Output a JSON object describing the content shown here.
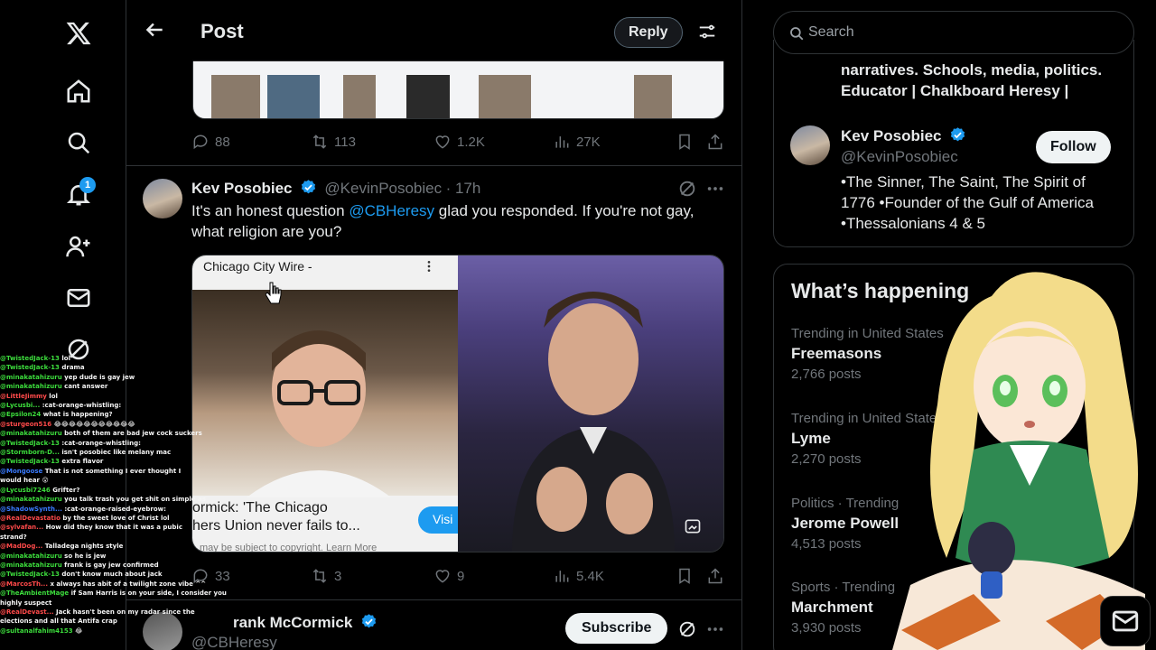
{
  "topbar": {
    "title": "Post",
    "reply_label": "Reply"
  },
  "nav": {
    "notification_count": "1"
  },
  "prev_tweet": {
    "replies": "88",
    "reposts": "113",
    "likes": "1.2K",
    "views": "27K"
  },
  "tweet": {
    "author": "Kev Posobiec",
    "handle": "@KevinPosobiec",
    "time": "· 17h",
    "text_before": "It's an honest question ",
    "mention": "@CBHeresy",
    "text_after": " glad you responded. If you're not gay, what religion are you?",
    "media": {
      "header": "Chicago City Wire -",
      "caption_line1": "ormick: 'The Chicago",
      "caption_line2": "hers Union never fails to...",
      "small_text": "may be subject to copyright.  Learn More",
      "visit_label": "Visi"
    },
    "replies": "33",
    "reposts": "3",
    "likes": "9",
    "views": "5.4K"
  },
  "next_tweet": {
    "author": "Frank McCormick",
    "author_visible": "rank McCormick",
    "handle": "@CBHeresy",
    "subscribe_label": "Subscribe"
  },
  "chat": [
    {
      "user": "@TwistedJack-13",
      "msg": "lol",
      "color": "green"
    },
    {
      "user": "@TwistedJack-13",
      "msg": "drama",
      "color": "green"
    },
    {
      "user": "@minakatahizuru",
      "msg": "yep dude is gay jew",
      "color": "green"
    },
    {
      "user": "@minakatahizuru",
      "msg": "cant answer",
      "color": "green"
    },
    {
      "user": "@LittleJimmy",
      "msg": "lol",
      "color": "red"
    },
    {
      "user": "@Lycusbi...",
      "msg": ":cat-orange-whistling:",
      "color": "green"
    },
    {
      "user": "@Epsilon24",
      "msg": "what is happening?",
      "color": "green"
    },
    {
      "user": "@sturgeon516",
      "msg": "😂😂😂😂😂😂😂😂😂😂😂",
      "color": "red"
    },
    {
      "user": "@minakatahizuru",
      "msg": "both of them are bad jew cock suckers",
      "color": "green"
    },
    {
      "user": "@TwistedJack-13",
      "msg": ":cat-orange-whistling:",
      "color": "green"
    },
    {
      "user": "@Stormborn-D...",
      "msg": "isn't posobiec like melany mac",
      "color": "green"
    },
    {
      "user": "@TwistedJack-13",
      "msg": "extra flavor",
      "color": "green"
    },
    {
      "user": "@Mongoose",
      "msg": "That is not something I ever thought I",
      "color": "blue"
    },
    {
      "user": "",
      "msg": "would hear 😮",
      "color": "green"
    },
    {
      "user": "@Lycusbi7246",
      "msg": "Grifter?",
      "color": "green"
    },
    {
      "user": "@minakatahizuru",
      "msg": "you talk trash you get shit on simple as",
      "color": "green"
    },
    {
      "user": "",
      "msg": "",
      "color": "green"
    },
    {
      "user": "@ShadowSynth...",
      "msg": ":cat-orange-raised-eyebrow:",
      "color": "blue"
    },
    {
      "user": "@RealDevastatio",
      "msg": "by the sweet love of Christ lol",
      "color": "red"
    },
    {
      "user": "@sylvafan...",
      "msg": "How did they know that it was a pubic",
      "color": "red"
    },
    {
      "user": "",
      "msg": "strand?",
      "color": "green"
    },
    {
      "user": "@MadDog...",
      "msg": "Talladega nights style",
      "color": "red"
    },
    {
      "user": "@minakatahizuru",
      "msg": "so he is jew",
      "color": "green"
    },
    {
      "user": "@minakatahizuru",
      "msg": "frank is gay jew confirmed",
      "color": "green"
    },
    {
      "user": "@TwistedJack-13",
      "msg": "don't know much about jack",
      "color": "green"
    },
    {
      "user": "@MarcosTh...",
      "msg": "x always has abit of a twilight zone vibe ^^",
      "color": "red"
    },
    {
      "user": "@TheAmbientMage",
      "msg": "if Sam Harris is on your side, I consider you",
      "color": "green"
    },
    {
      "user": "",
      "msg": "highly suspect",
      "color": "green"
    },
    {
      "user": "@RealDevast...",
      "msg": "Jack hasn't been on my radar since the",
      "color": "red"
    },
    {
      "user": "",
      "msg": "elections and all that Antifa crap",
      "color": "green"
    },
    {
      "user": "@sultanalfahim4153",
      "msg": "😂",
      "color": "green"
    }
  ],
  "sidebar": {
    "search_placeholder": "Search",
    "prev_bio_line1": "narratives. Schools, media, politics.",
    "prev_bio_line2": "Educator | Chalkboard Heresy |",
    "profile": {
      "name": "Kev Posobiec",
      "handle": "@KevinPosobiec",
      "follow_label": "Follow",
      "bio_line1": "•The Sinner, The Saint, The Spirit of",
      "bio_line2": "1776 •Founder of the Gulf of America",
      "bio_line3": "•Thessalonians 4 & 5"
    },
    "trends_title": "What’s happening",
    "trends": [
      {
        "context": "Trending in United States",
        "name": "Freemasons",
        "count": "2,766 posts"
      },
      {
        "context": "Trending in United States",
        "name": "Lyme",
        "count": "2,270 posts"
      },
      {
        "context": "Politics · Trending",
        "name": "Jerome Powell",
        "count": "4,513 posts"
      },
      {
        "context": "Sports · Trending",
        "name": "Marchment",
        "count": "3,930 posts"
      }
    ]
  },
  "colors": {
    "accent": "#1d9bf0",
    "background": "#000000",
    "border": "#2f3336",
    "muted": "#71767b"
  }
}
